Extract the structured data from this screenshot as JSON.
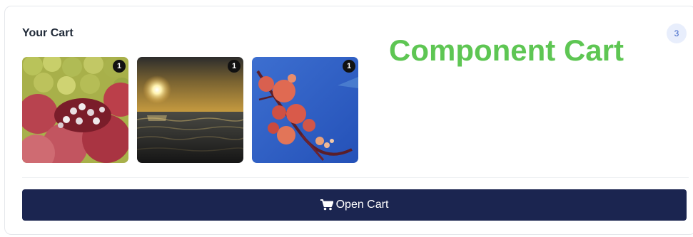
{
  "cart": {
    "title": "Your Cart",
    "count": "3",
    "items": [
      {
        "quantity": "1",
        "image": "pomegranates-photo"
      },
      {
        "quantity": "1",
        "image": "sunset-sea-photo"
      },
      {
        "quantity": "1",
        "image": "red-flower-branch-photo"
      }
    ],
    "open_label": "Open Cart",
    "open_icon": "shopping-cart-icon"
  },
  "watermark": "Component Cart",
  "colors": {
    "button_bg": "#1b2550",
    "watermark": "#5ec653",
    "badge_bg": "#e8eefc",
    "badge_text": "#3b63c7"
  }
}
